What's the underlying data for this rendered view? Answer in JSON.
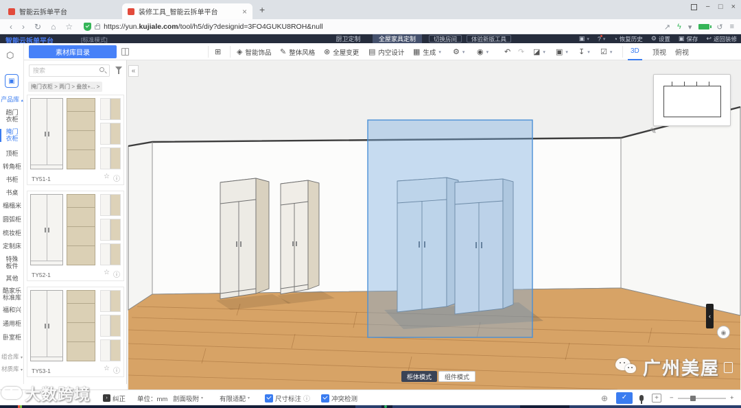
{
  "browser": {
    "tab1": "智能云拆单平台",
    "tab2": "装修工具_智能云拆单平台",
    "new_tab": "+",
    "url_prefix": "https://yun.",
    "url_domain": "kujiale.com",
    "url_path": "/tool/h5/diy?designid=3FO4GUKU8ROH&null"
  },
  "header": {
    "title": "智能云拆单平台",
    "mode": "[标准模式]",
    "nav_kitchen": "厨卫定制",
    "nav_furniture": "全屋家具定制",
    "btn_switch_room": "切换房间",
    "btn_new_tool": "体验新版工具",
    "help": "?",
    "right": {
      "history": "恢复历史",
      "settings": "设置",
      "save": "保存",
      "back": "返回装修"
    }
  },
  "toolbar": {
    "library_button": "素材库目录",
    "items": [
      {
        "label": "智能饰品"
      },
      {
        "label": "整体风格"
      },
      {
        "label": "全屋变更"
      },
      {
        "label": "内空设计"
      },
      {
        "label": "生成"
      }
    ],
    "views": [
      {
        "label": "3D"
      },
      {
        "label": "顶视"
      },
      {
        "label": "俯视"
      }
    ]
  },
  "sidebar": {
    "header": "产品库",
    "items": [
      {
        "label": "趟门\n衣柜"
      },
      {
        "label": "掩门\n衣柜"
      },
      {
        "label": "顶柜"
      },
      {
        "label": "转角柜"
      },
      {
        "label": "书柜"
      },
      {
        "label": "书桌"
      },
      {
        "label": "榻榻米"
      },
      {
        "label": "圆弧柜"
      },
      {
        "label": "梳妆柜"
      },
      {
        "label": "定制床"
      },
      {
        "label": "特殊\n板件"
      },
      {
        "label": "其他"
      },
      {
        "label": "酷家乐\n标准库"
      },
      {
        "label": "福和兴"
      },
      {
        "label": "通用柜"
      },
      {
        "label": "卧室柜"
      }
    ],
    "footer": [
      {
        "label": "组合库"
      },
      {
        "label": "材质库"
      }
    ]
  },
  "panel": {
    "search_placeholder": "搜索",
    "breadcrumb": "掩门衣柜 > 两门 > 叠放+... >",
    "products": [
      {
        "name": "TY51-1"
      },
      {
        "name": "TY52-1"
      },
      {
        "name": "TY53-1"
      }
    ]
  },
  "viewport": {
    "mode_cabinet": "柜体模式",
    "mode_component": "组件模式",
    "watermark_left": "大数跨境",
    "watermark_right": "广州美屋"
  },
  "statusbar": {
    "correct": "纠正",
    "unit": "单位：mm",
    "section_snap": "剖面吸附",
    "limited_fit": "有限适配",
    "dim_label": "尺寸标注",
    "conflict_label": "冲突检测"
  },
  "icons": {
    "back": "‹",
    "forward": "›",
    "refresh": "↻",
    "home": "⌂",
    "fav": "☆",
    "share": "↗",
    "lightning": "ϟ",
    "caret": "▾",
    "restore": "↺",
    "menu": "≡",
    "minimize": "−",
    "maximize": "□",
    "close": "×",
    "grid": "⊞",
    "smart": "◈",
    "style_tool": "✎",
    "change": "⊗",
    "interior": "▤",
    "generate": "▦",
    "key": "⚙",
    "eye": "◉",
    "undo": "↶",
    "redo": "↷",
    "eraser": "◪",
    "frame": "▣",
    "download": "↧",
    "checklist": "☑",
    "cube": "⬡",
    "collapse": "«",
    "handle": "‹",
    "star": "☆",
    "info": "ⓘ",
    "pencil": "✎",
    "globe": "⊕",
    "check": "✓",
    "clock": "◔",
    "gear": "⚙",
    "save": "▣",
    "return": "↩",
    "plus": "+",
    "minus": "−",
    "app": "▣"
  },
  "colors": {
    "accent": "#3a7cf0",
    "header_bg": "#262d3d",
    "selection": "#4a90d6",
    "floor": "#d7a366"
  }
}
